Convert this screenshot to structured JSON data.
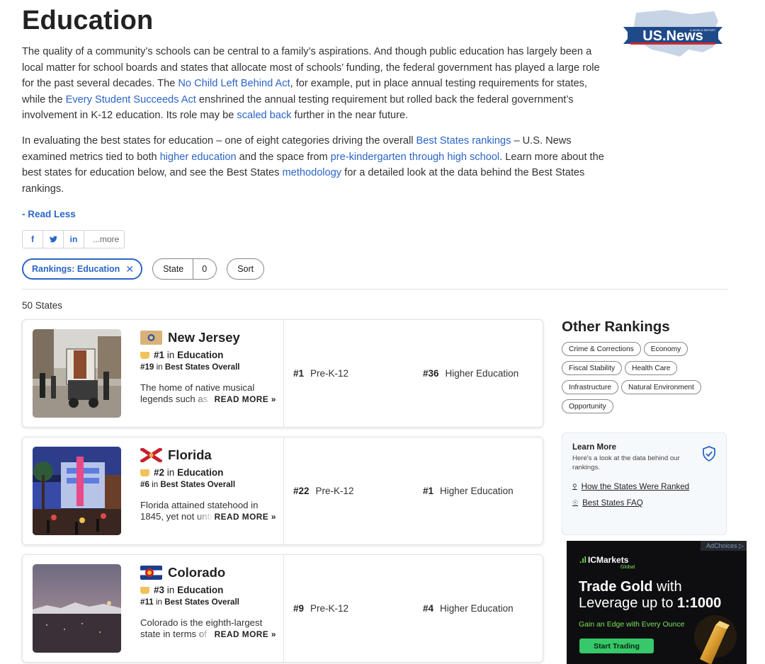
{
  "page": {
    "title": "Education",
    "intro_p1": [
      {
        "text": "The quality of a community’s schools can be central to a family’s aspirations. And though public education has largely been a local matter for school boards and states that allocate most of schools’ funding, the federal government has played a large role for the past several decades. The "
      },
      {
        "link": "No Child Left Behind Act"
      },
      {
        "text": ", for example, put in place annual testing requirements for states, while the "
      },
      {
        "link": "Every Student Succeeds Act"
      },
      {
        "text": " enshrined the annual testing requirement but rolled back the federal government’s involvement in K-12 education. Its role may be "
      },
      {
        "link": "scaled back"
      },
      {
        "text": " further in the near future."
      }
    ],
    "intro_p2": [
      {
        "text": "In evaluating the best states for education – one of eight categories driving the overall "
      },
      {
        "link": "Best States rankings"
      },
      {
        "text": " – U.S. News examined metrics tied to both "
      },
      {
        "link": "higher education"
      },
      {
        "text": " and the space from "
      },
      {
        "link": "pre-kindergarten through high school"
      },
      {
        "text": ". Learn more about the best states for education below, and see the Best States "
      },
      {
        "link": "methodology"
      },
      {
        "text": " for a detailed look at the data behind the Best States rankings."
      }
    ],
    "read_less": "- Read Less",
    "logo_text": "US.News",
    "logo_sub": "& WORLD REPORT"
  },
  "share": {
    "facebook": "f",
    "twitter": "🐦",
    "linkedin": "in",
    "more": "...more"
  },
  "filters": {
    "active": "Rankings: Education",
    "active_close": "✕",
    "state_label": "State",
    "state_count": "0",
    "sort": "Sort"
  },
  "results": {
    "count": "50 States"
  },
  "states": [
    {
      "name": "New Jersey",
      "rank_cat": "#1",
      "in1": "in",
      "cat": "Education",
      "rank_overall": "#19",
      "in2": "in",
      "overall_label": "Best States Overall",
      "blurb": "The home of native musical legends such as",
      "read_more": "READ MORE »",
      "prek_rank": "#1",
      "prek_label": "Pre-K-12",
      "higher_rank": "#36",
      "higher_label": "Higher Education"
    },
    {
      "name": "Florida",
      "rank_cat": "#2",
      "in1": "in",
      "cat": "Education",
      "rank_overall": "#6",
      "in2": "in",
      "overall_label": "Best States Overall",
      "blurb": "Florida attained statehood in 1845, yet not until",
      "read_more": "READ MORE »",
      "prek_rank": "#22",
      "prek_label": "Pre-K-12",
      "higher_rank": "#1",
      "higher_label": "Higher Education"
    },
    {
      "name": "Colorado",
      "rank_cat": "#3",
      "in1": "in",
      "cat": "Education",
      "rank_overall": "#11",
      "in2": "in",
      "overall_label": "Best States Overall",
      "blurb": "Colorado is the eighth-largest state in terms of",
      "read_more": "READ MORE »",
      "prek_rank": "#9",
      "prek_label": "Pre-K-12",
      "higher_rank": "#4",
      "higher_label": "Higher Education"
    }
  ],
  "other_rankings": {
    "title": "Other Rankings",
    "tags": [
      "Crime & Corrections",
      "Economy",
      "Fiscal Stability",
      "Health Care",
      "Infrastructure",
      "Natural Environment",
      "Opportunity"
    ]
  },
  "learn_more": {
    "title": "Learn More",
    "desc": "Here's a look at the data behind our rankings.",
    "link1": "How the States Were Ranked",
    "link2": "Best States FAQ"
  },
  "ad": {
    "choices": "AdChoices ▷",
    "brand": "ICMarkets",
    "brand_sub": "Global",
    "headline_a": "Trade Gold",
    "headline_b": " with Leverage up to ",
    "headline_c": "1:1000",
    "tagline": "Gain an Edge with Every Ounce",
    "cta": "Start Trading"
  },
  "colors": {
    "link": "#2a65c7",
    "medal": "#f2c25a",
    "ad_green": "#37c86a"
  }
}
